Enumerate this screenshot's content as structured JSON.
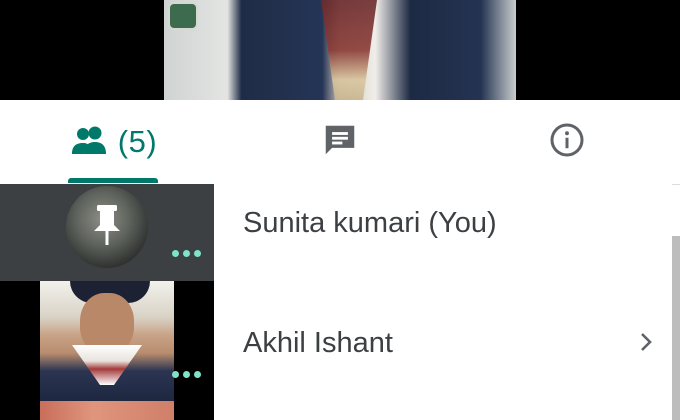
{
  "tabs": [
    {
      "id": "people",
      "icon": "people-icon",
      "label": "(5)",
      "active": true
    },
    {
      "id": "chat",
      "icon": "chat-message-icon",
      "active": false
    },
    {
      "id": "info",
      "icon": "info-icon",
      "active": false
    }
  ],
  "colors": {
    "accent": "#00796b",
    "more_dots": "#7ee3c8",
    "name_text": "#3c4043",
    "active_tile_bg": "#3c4043"
  },
  "participants": [
    {
      "name": "Sunita kumari (You)",
      "tile_icon": "pin-icon",
      "more_icon": "more-options-icon"
    },
    {
      "name": "Akhil Ishant",
      "row_icon": "chevron-right-icon",
      "more_icon": "more-options-icon"
    }
  ]
}
